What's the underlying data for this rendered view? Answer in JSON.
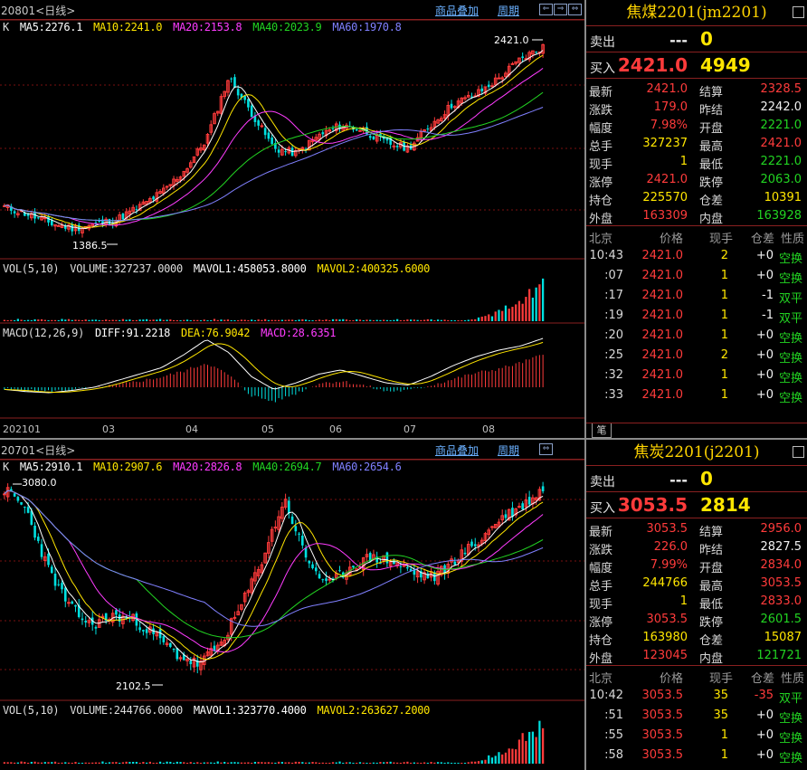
{
  "top": {
    "header": {
      "code": "20801",
      "period": "日线",
      "menu_overlay": "商品叠加",
      "menu_cycle": "周期"
    },
    "ma_line": {
      "prefix": "K",
      "ma5": "MA5:2276.1",
      "ma10": "MA10:2241.0",
      "ma20": "MA20:2153.8",
      "ma40": "MA40:2023.9",
      "ma60": "MA60:1970.8"
    },
    "high_marker": "2421.0",
    "low_marker": "1386.5",
    "vol_line": {
      "label": "VOL(5,10)",
      "volume": "VOLUME:327237.0000",
      "mavol1": "MAVOL1:458053.8000",
      "mavol2": "MAVOL2:400325.6000"
    },
    "macd_line": {
      "label": "MACD(12,26,9)",
      "diff": "DIFF:91.2218",
      "dea": "DEA:76.9042",
      "macd": "MACD:28.6351"
    },
    "x_axis": [
      "202101",
      "03",
      "04",
      "05",
      "06",
      "07",
      "08"
    ],
    "quote": {
      "title": "焦煤2201(jm2201)",
      "sell_label": "卖出",
      "sell_price": "---",
      "sell_vol": "0",
      "buy_label": "买入",
      "buy_price": "2421.0",
      "buy_vol": "4949",
      "stats": [
        {
          "l1": "最新",
          "v1": "2421.0",
          "c1": "red",
          "l2": "结算",
          "v2": "2328.5",
          "c2": "red"
        },
        {
          "l1": "涨跌",
          "v1": "179.0",
          "c1": "red",
          "l2": "昨结",
          "v2": "2242.0",
          "c2": "wht"
        },
        {
          "l1": "幅度",
          "v1": "7.98%",
          "c1": "red",
          "l2": "开盘",
          "v2": "2221.0",
          "c2": "grn"
        },
        {
          "l1": "总手",
          "v1": "327237",
          "c1": "yel",
          "l2": "最高",
          "v2": "2421.0",
          "c2": "red"
        },
        {
          "l1": "现手",
          "v1": "1",
          "c1": "yel",
          "l2": "最低",
          "v2": "2221.0",
          "c2": "grn"
        },
        {
          "l1": "涨停",
          "v1": "2421.0",
          "c1": "red",
          "l2": "跌停",
          "v2": "2063.0",
          "c2": "grn"
        },
        {
          "l1": "持仓",
          "v1": "225570",
          "c1": "yel",
          "l2": "仓差",
          "v2": "10391",
          "c2": "yel"
        },
        {
          "l1": "外盘",
          "v1": "163309",
          "c1": "red",
          "l2": "内盘",
          "v2": "163928",
          "c2": "grn"
        }
      ],
      "tick_head": {
        "loc": "北京",
        "price": "价格",
        "vol": "现手",
        "oi": "仓差",
        "nat": "性质"
      },
      "ticks": [
        {
          "time": "10:43",
          "price": "2421.0",
          "vol": "2",
          "oi": "+0",
          "nat": "空换",
          "natc": "grn",
          "oic": "wht"
        },
        {
          "time": ":07",
          "price": "2421.0",
          "vol": "1",
          "oi": "+0",
          "nat": "空换",
          "natc": "grn",
          "oic": "wht"
        },
        {
          "time": ":17",
          "price": "2421.0",
          "vol": "1",
          "oi": "-1",
          "nat": "双平",
          "natc": "grn",
          "oic": "wht"
        },
        {
          "time": ":19",
          "price": "2421.0",
          "vol": "1",
          "oi": "-1",
          "nat": "双平",
          "natc": "grn",
          "oic": "wht"
        },
        {
          "time": ":20",
          "price": "2421.0",
          "vol": "1",
          "oi": "+0",
          "nat": "空换",
          "natc": "grn",
          "oic": "wht"
        },
        {
          "time": ":25",
          "price": "2421.0",
          "vol": "2",
          "oi": "+0",
          "nat": "空换",
          "natc": "grn",
          "oic": "wht"
        },
        {
          "time": ":32",
          "price": "2421.0",
          "vol": "1",
          "oi": "+0",
          "nat": "空换",
          "natc": "grn",
          "oic": "wht"
        },
        {
          "time": ":33",
          "price": "2421.0",
          "vol": "1",
          "oi": "+0",
          "nat": "空换",
          "natc": "grn",
          "oic": "wht"
        }
      ],
      "tab": "笔"
    }
  },
  "bottom": {
    "header": {
      "code": "20701",
      "period": "日线",
      "menu_overlay": "商品叠加",
      "menu_cycle": "周期"
    },
    "ma_line": {
      "prefix": "K",
      "ma5": "MA5:2910.1",
      "ma10": "MA10:2907.6",
      "ma20": "MA20:2826.8",
      "ma40": "MA40:2694.7",
      "ma60": "MA60:2654.6"
    },
    "high_marker": "3080.0",
    "low_marker": "2102.5",
    "vol_line": {
      "label": "VOL(5,10)",
      "volume": "VOLUME:244766.0000",
      "mavol1": "MAVOL1:323770.4000",
      "mavol2": "MAVOL2:263627.2000"
    },
    "quote": {
      "title": "焦炭2201(j2201)",
      "sell_label": "卖出",
      "sell_price": "---",
      "sell_vol": "0",
      "buy_label": "买入",
      "buy_price": "3053.5",
      "buy_vol": "2814",
      "stats": [
        {
          "l1": "最新",
          "v1": "3053.5",
          "c1": "red",
          "l2": "结算",
          "v2": "2956.0",
          "c2": "red"
        },
        {
          "l1": "涨跌",
          "v1": "226.0",
          "c1": "red",
          "l2": "昨结",
          "v2": "2827.5",
          "c2": "wht"
        },
        {
          "l1": "幅度",
          "v1": "7.99%",
          "c1": "red",
          "l2": "开盘",
          "v2": "2834.0",
          "c2": "red"
        },
        {
          "l1": "总手",
          "v1": "244766",
          "c1": "yel",
          "l2": "最高",
          "v2": "3053.5",
          "c2": "red"
        },
        {
          "l1": "现手",
          "v1": "1",
          "c1": "yel",
          "l2": "最低",
          "v2": "2833.0",
          "c2": "red"
        },
        {
          "l1": "涨停",
          "v1": "3053.5",
          "c1": "red",
          "l2": "跌停",
          "v2": "2601.5",
          "c2": "grn"
        },
        {
          "l1": "持仓",
          "v1": "163980",
          "c1": "yel",
          "l2": "仓差",
          "v2": "15087",
          "c2": "yel"
        },
        {
          "l1": "外盘",
          "v1": "123045",
          "c1": "red",
          "l2": "内盘",
          "v2": "121721",
          "c2": "grn"
        }
      ],
      "tick_head": {
        "loc": "北京",
        "price": "价格",
        "vol": "现手",
        "oi": "仓差",
        "nat": "性质"
      },
      "ticks": [
        {
          "time": "10:42",
          "price": "3053.5",
          "vol": "35",
          "oi": "-35",
          "nat": "双平",
          "natc": "grn",
          "oic": "red"
        },
        {
          "time": ":51",
          "price": "3053.5",
          "vol": "35",
          "oi": "+0",
          "nat": "空换",
          "natc": "grn",
          "oic": "wht"
        },
        {
          "time": ":55",
          "price": "3053.5",
          "vol": "1",
          "oi": "+0",
          "nat": "空换",
          "natc": "grn",
          "oic": "wht"
        },
        {
          "time": ":58",
          "price": "3053.5",
          "vol": "1",
          "oi": "+0",
          "nat": "空换",
          "natc": "grn",
          "oic": "wht"
        }
      ]
    }
  },
  "colors": {
    "ma5": "#ffffff",
    "ma10": "#ffe600",
    "ma20": "#ff3cff",
    "ma40": "#22d422",
    "ma60": "#8080ff",
    "up": "#ff3b3b",
    "down": "#00e0e0"
  }
}
